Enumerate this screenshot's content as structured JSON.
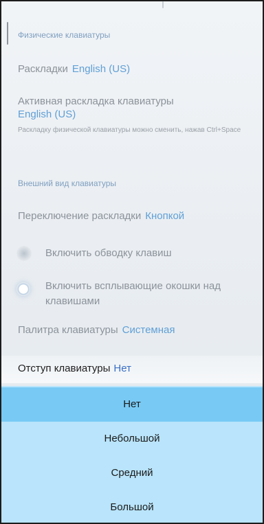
{
  "sections": {
    "physical": {
      "title": "Физические клавиатуры",
      "layouts_label": "Раскладки",
      "layouts_value": "English (US)",
      "active_label": "Активная раскладка клавиатуры",
      "active_value": "English (US)",
      "active_desc": "Раскладку физической клавиатуры можно сменить, нажав Ctrl+Space"
    },
    "appearance": {
      "title": "Внешний вид клавиатуры",
      "switch_label": "Переключение раскладки",
      "switch_value": "Кнопкой",
      "outline_label": "Включить обводку клавиш",
      "popup_label": "Включить всплывающие окошки над клавишами",
      "palette_label": "Палитра клавиатуры",
      "palette_value": "Системная",
      "indent_label": "Отступ клавиатуры",
      "indent_value": "Нет"
    }
  },
  "dropdown": {
    "options": [
      "Нет",
      "Небольшой",
      "Средний",
      "Большой"
    ],
    "selected": "Нет"
  },
  "colors": {
    "accent": "#5f9fd6",
    "dropdown_bg": "#b9e4fb",
    "dropdown_selected": "#78caf5"
  }
}
